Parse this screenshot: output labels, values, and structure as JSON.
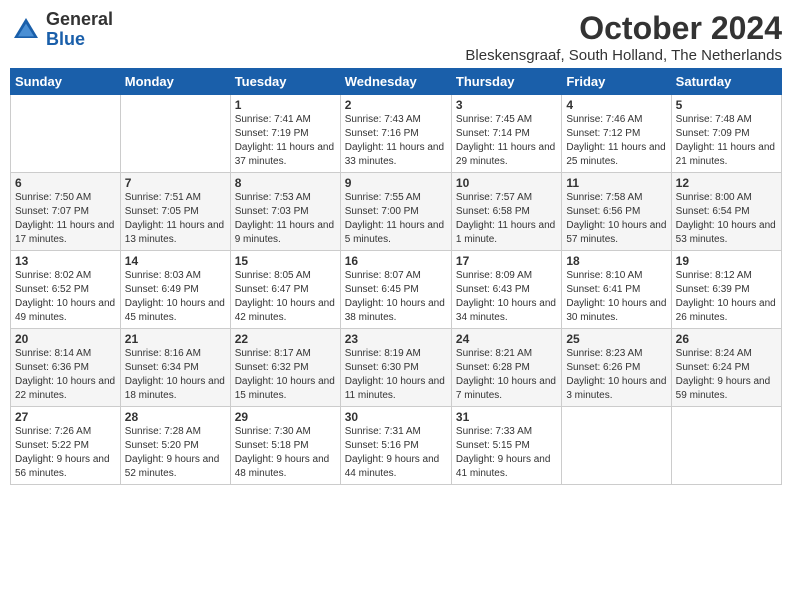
{
  "header": {
    "logo_general": "General",
    "logo_blue": "Blue",
    "month_year": "October 2024",
    "location": "Bleskensgraaf, South Holland, The Netherlands"
  },
  "weekdays": [
    "Sunday",
    "Monday",
    "Tuesday",
    "Wednesday",
    "Thursday",
    "Friday",
    "Saturday"
  ],
  "weeks": [
    [
      {
        "day": "",
        "info": ""
      },
      {
        "day": "",
        "info": ""
      },
      {
        "day": "1",
        "info": "Sunrise: 7:41 AM\nSunset: 7:19 PM\nDaylight: 11 hours and 37 minutes."
      },
      {
        "day": "2",
        "info": "Sunrise: 7:43 AM\nSunset: 7:16 PM\nDaylight: 11 hours and 33 minutes."
      },
      {
        "day": "3",
        "info": "Sunrise: 7:45 AM\nSunset: 7:14 PM\nDaylight: 11 hours and 29 minutes."
      },
      {
        "day": "4",
        "info": "Sunrise: 7:46 AM\nSunset: 7:12 PM\nDaylight: 11 hours and 25 minutes."
      },
      {
        "day": "5",
        "info": "Sunrise: 7:48 AM\nSunset: 7:09 PM\nDaylight: 11 hours and 21 minutes."
      }
    ],
    [
      {
        "day": "6",
        "info": "Sunrise: 7:50 AM\nSunset: 7:07 PM\nDaylight: 11 hours and 17 minutes."
      },
      {
        "day": "7",
        "info": "Sunrise: 7:51 AM\nSunset: 7:05 PM\nDaylight: 11 hours and 13 minutes."
      },
      {
        "day": "8",
        "info": "Sunrise: 7:53 AM\nSunset: 7:03 PM\nDaylight: 11 hours and 9 minutes."
      },
      {
        "day": "9",
        "info": "Sunrise: 7:55 AM\nSunset: 7:00 PM\nDaylight: 11 hours and 5 minutes."
      },
      {
        "day": "10",
        "info": "Sunrise: 7:57 AM\nSunset: 6:58 PM\nDaylight: 11 hours and 1 minute."
      },
      {
        "day": "11",
        "info": "Sunrise: 7:58 AM\nSunset: 6:56 PM\nDaylight: 10 hours and 57 minutes."
      },
      {
        "day": "12",
        "info": "Sunrise: 8:00 AM\nSunset: 6:54 PM\nDaylight: 10 hours and 53 minutes."
      }
    ],
    [
      {
        "day": "13",
        "info": "Sunrise: 8:02 AM\nSunset: 6:52 PM\nDaylight: 10 hours and 49 minutes."
      },
      {
        "day": "14",
        "info": "Sunrise: 8:03 AM\nSunset: 6:49 PM\nDaylight: 10 hours and 45 minutes."
      },
      {
        "day": "15",
        "info": "Sunrise: 8:05 AM\nSunset: 6:47 PM\nDaylight: 10 hours and 42 minutes."
      },
      {
        "day": "16",
        "info": "Sunrise: 8:07 AM\nSunset: 6:45 PM\nDaylight: 10 hours and 38 minutes."
      },
      {
        "day": "17",
        "info": "Sunrise: 8:09 AM\nSunset: 6:43 PM\nDaylight: 10 hours and 34 minutes."
      },
      {
        "day": "18",
        "info": "Sunrise: 8:10 AM\nSunset: 6:41 PM\nDaylight: 10 hours and 30 minutes."
      },
      {
        "day": "19",
        "info": "Sunrise: 8:12 AM\nSunset: 6:39 PM\nDaylight: 10 hours and 26 minutes."
      }
    ],
    [
      {
        "day": "20",
        "info": "Sunrise: 8:14 AM\nSunset: 6:36 PM\nDaylight: 10 hours and 22 minutes."
      },
      {
        "day": "21",
        "info": "Sunrise: 8:16 AM\nSunset: 6:34 PM\nDaylight: 10 hours and 18 minutes."
      },
      {
        "day": "22",
        "info": "Sunrise: 8:17 AM\nSunset: 6:32 PM\nDaylight: 10 hours and 15 minutes."
      },
      {
        "day": "23",
        "info": "Sunrise: 8:19 AM\nSunset: 6:30 PM\nDaylight: 10 hours and 11 minutes."
      },
      {
        "day": "24",
        "info": "Sunrise: 8:21 AM\nSunset: 6:28 PM\nDaylight: 10 hours and 7 minutes."
      },
      {
        "day": "25",
        "info": "Sunrise: 8:23 AM\nSunset: 6:26 PM\nDaylight: 10 hours and 3 minutes."
      },
      {
        "day": "26",
        "info": "Sunrise: 8:24 AM\nSunset: 6:24 PM\nDaylight: 9 hours and 59 minutes."
      }
    ],
    [
      {
        "day": "27",
        "info": "Sunrise: 7:26 AM\nSunset: 5:22 PM\nDaylight: 9 hours and 56 minutes."
      },
      {
        "day": "28",
        "info": "Sunrise: 7:28 AM\nSunset: 5:20 PM\nDaylight: 9 hours and 52 minutes."
      },
      {
        "day": "29",
        "info": "Sunrise: 7:30 AM\nSunset: 5:18 PM\nDaylight: 9 hours and 48 minutes."
      },
      {
        "day": "30",
        "info": "Sunrise: 7:31 AM\nSunset: 5:16 PM\nDaylight: 9 hours and 44 minutes."
      },
      {
        "day": "31",
        "info": "Sunrise: 7:33 AM\nSunset: 5:15 PM\nDaylight: 9 hours and 41 minutes."
      },
      {
        "day": "",
        "info": ""
      },
      {
        "day": "",
        "info": ""
      }
    ]
  ]
}
